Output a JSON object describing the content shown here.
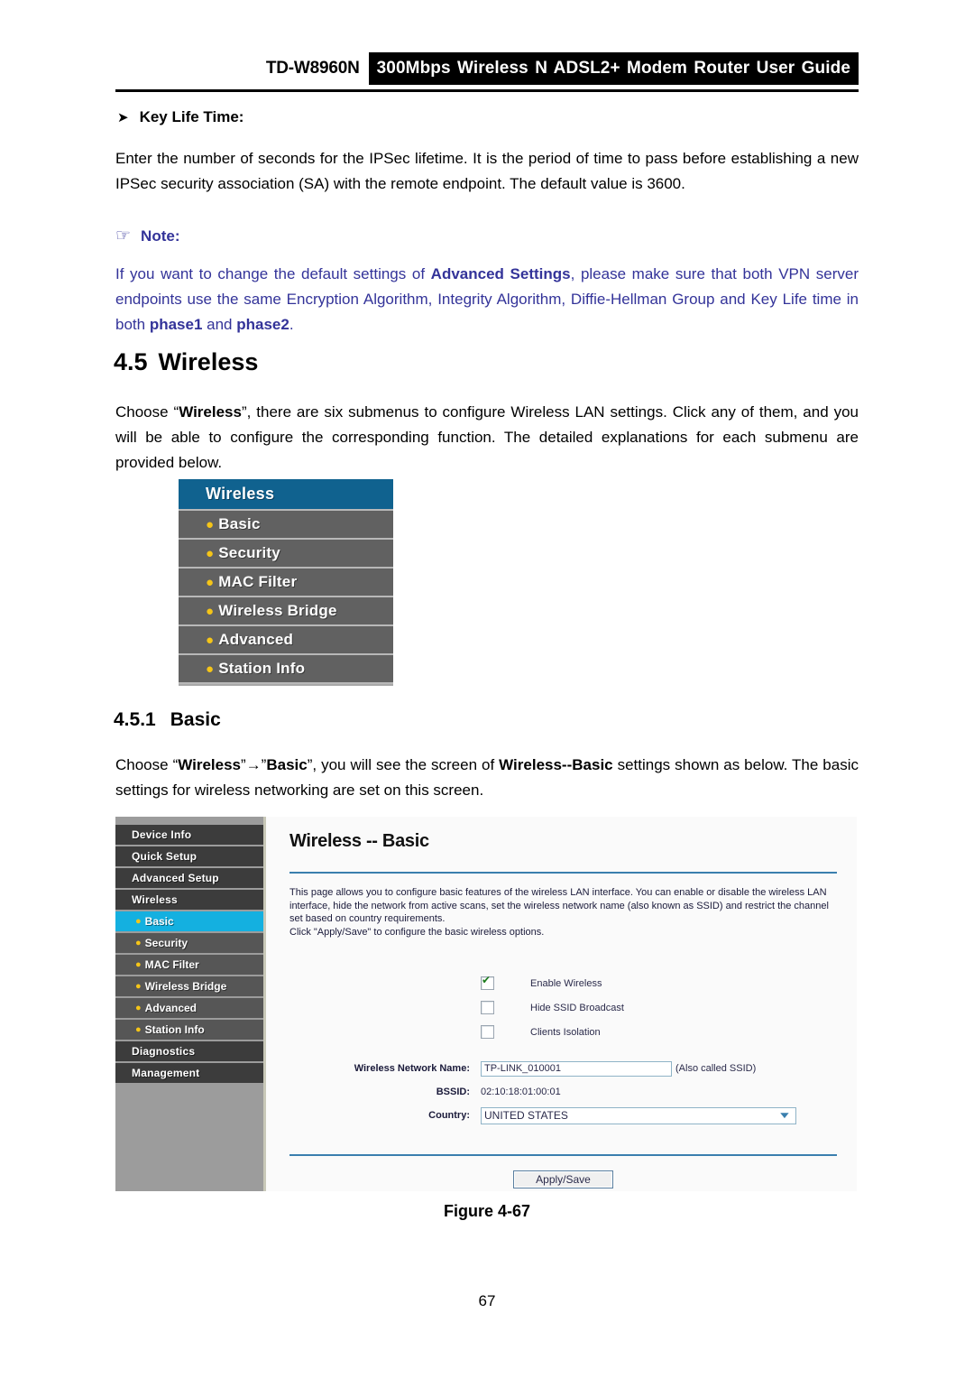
{
  "header": {
    "model": "TD-W8960N",
    "title": "300Mbps Wireless N ADSL2+ Modem Router User Guide"
  },
  "key_life_time": {
    "arrow_icon": "right-triangle-bullet",
    "heading": "Key Life Time:",
    "body": "Enter the number of seconds for the IPSec lifetime. It is the period of time to pass before establishing a new IPSec security association (SA) with the remote endpoint. The default value is 3600."
  },
  "note": {
    "hand_icon": "pointing-hand",
    "label": "Note:",
    "text_part1": "If you want to change the default settings of ",
    "bold1": "Advanced Settings",
    "text_part2": ", please make sure that both VPN server endpoints use the same Encryption Algorithm, Integrity Algorithm, Diffie-Hellman Group and Key Life time in both ",
    "bold2": "phase1",
    "text_part3": " and ",
    "bold3": "phase2",
    "text_part4": ".",
    "color": "#333399"
  },
  "section_45": {
    "number": "4.5",
    "title": "Wireless",
    "intro_part1": "Choose “",
    "intro_bold1": "Wireless",
    "intro_part2": "”, there are six submenus to configure Wireless LAN settings. Click any of them, and you will be able to configure the corresponding function. The detailed explanations for each submenu are provided below."
  },
  "submenu_figure": {
    "header": "Wireless",
    "header_color": "#10628f",
    "item_color": "#616161",
    "bullet_color": "#f5c518",
    "items": [
      {
        "label": "Basic"
      },
      {
        "label": "Security"
      },
      {
        "label": "MAC Filter"
      },
      {
        "label": "Wireless Bridge"
      },
      {
        "label": "Advanced"
      },
      {
        "label": "Station Info"
      }
    ]
  },
  "section_451": {
    "number": "4.5.1",
    "title": "Basic",
    "intro_part1": "Choose “",
    "intro_bold1": "Wireless",
    "intro_part2": "”→”",
    "intro_bold2": "Basic",
    "intro_part3": "”, you will see the screen of ",
    "intro_bold3": "Wireless--Basic",
    "intro_part4": " settings shown as below. The basic settings for wireless networking are set on this screen."
  },
  "screenshot": {
    "sidebar": {
      "top_items": [
        {
          "label": "Device Info"
        },
        {
          "label": "Quick Setup"
        },
        {
          "label": "Advanced Setup"
        },
        {
          "label": "Wireless"
        }
      ],
      "sub_items": [
        {
          "label": "Basic",
          "active": true
        },
        {
          "label": "Security",
          "active": false
        },
        {
          "label": "MAC Filter",
          "active": false
        },
        {
          "label": "Wireless Bridge",
          "active": false
        },
        {
          "label": "Advanced",
          "active": false
        },
        {
          "label": "Station Info",
          "active": false
        }
      ],
      "bottom_items": [
        {
          "label": "Diagnostics"
        },
        {
          "label": "Management"
        }
      ],
      "active_color": "#14b0e0"
    },
    "panel": {
      "title": "Wireless -- Basic",
      "description_line1": "This page allows you to configure basic features of the wireless LAN interface. You can enable or disable the wireless LAN interface, hide the network from active scans, set the wireless network name (also known as SSID) and restrict the channel set based on country requirements.",
      "description_line2": "Click \"Apply/Save\" to configure the basic wireless options.",
      "checkboxes": [
        {
          "label": "Enable Wireless",
          "checked": true
        },
        {
          "label": "Hide SSID Broadcast",
          "checked": false
        },
        {
          "label": "Clients Isolation",
          "checked": false
        }
      ],
      "fields": {
        "ssid_label": "Wireless Network Name:",
        "ssid_value": "TP-LINK_010001",
        "ssid_hint": "(Also called SSID)",
        "bssid_label": "BSSID:",
        "bssid_value": "02:10:18:01:00:01",
        "country_label": "Country:",
        "country_value": "UNITED STATES"
      },
      "apply_button": "Apply/Save",
      "divider_color": "#3a7fae"
    }
  },
  "figure_caption": "Figure 4-67",
  "page_number": "67"
}
